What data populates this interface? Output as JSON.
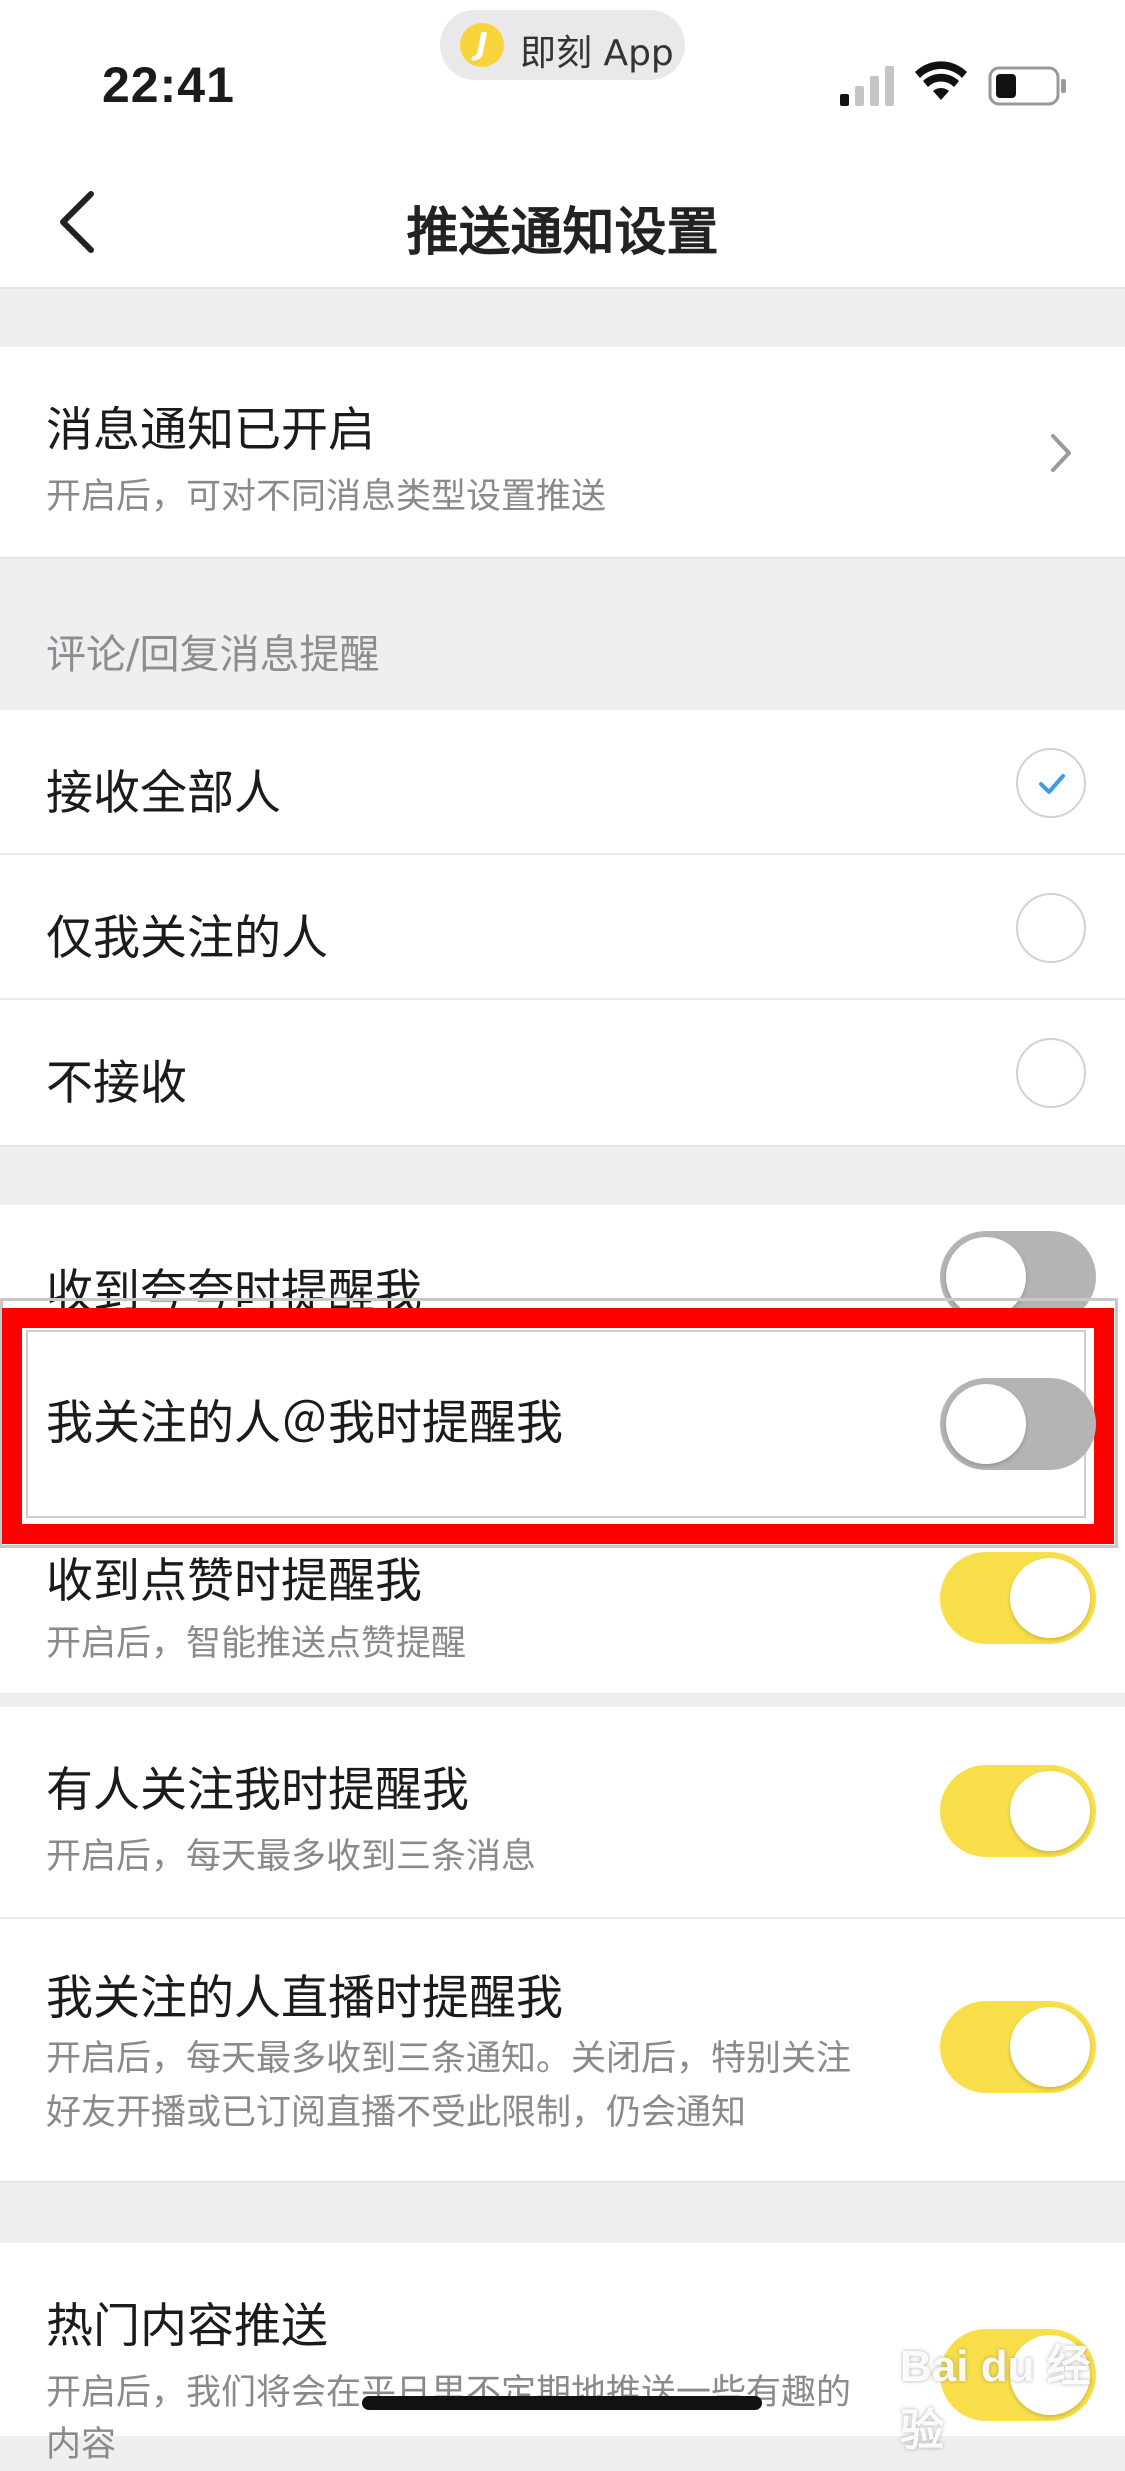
{
  "status_bar": {
    "time": "22:41",
    "app_name": "即刻 App",
    "app_logo_letter": "J",
    "icons": [
      "signal-icon",
      "wifi-icon",
      "battery-icon"
    ]
  },
  "nav": {
    "title": "推送通知设置",
    "back_icon": "chevron-left-icon"
  },
  "notification_status": {
    "title": "消息通知已开启",
    "subtitle": "开启后，可对不同消息类型设置推送"
  },
  "comment_section": {
    "label": "评论/回复消息提醒",
    "options": [
      {
        "label": "接收全部人",
        "selected": true
      },
      {
        "label": "仅我关注的人",
        "selected": false
      },
      {
        "label": "不接收",
        "selected": false
      }
    ]
  },
  "toggles": {
    "praise": {
      "label": "收到夸夸时提醒我",
      "on": false
    },
    "mention": {
      "label": "我关注的人＠我时提醒我",
      "on": false
    },
    "like": {
      "label": "收到点赞时提醒我",
      "subtitle": "开启后，智能推送点赞提醒",
      "on": true
    },
    "follow": {
      "label": "有人关注我时提醒我",
      "subtitle": "开启后，每天最多收到三条消息",
      "on": true
    },
    "live": {
      "label": "我关注的人直播时提醒我",
      "subtitle_line1": "开启后，每天最多收到三条通知。关闭后，特别关注",
      "subtitle_line2": "好友开播或已订阅直播不受此限制，仍会通知",
      "on": true
    },
    "hot": {
      "label": "热门内容推送",
      "subtitle": "开启后，我们将会在平日里不定期地推送一些有趣的",
      "subtitle_line2": "内容",
      "on": true
    }
  },
  "colors": {
    "toggle_on": "#f8df4a",
    "toggle_off": "#b4b4b4",
    "check": "#3a9be8",
    "highlight": "#ff0000"
  },
  "watermark": "Bai du 经验"
}
